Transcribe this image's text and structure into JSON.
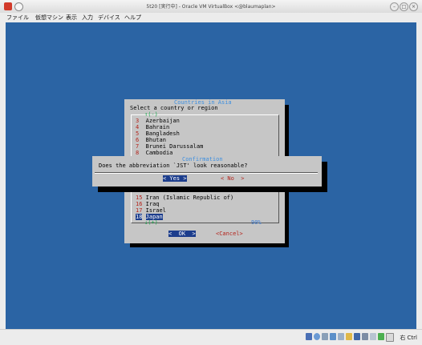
{
  "window": {
    "title": "5t20 [実行中] - Oracle VM VirtualBox <@blaumaplan>"
  },
  "menu": [
    "ファイル",
    "仮想マシン",
    "表示",
    "入力",
    "デバイス",
    "ヘルプ"
  ],
  "status": {
    "host_key": "右 Ctrl"
  },
  "countries_dialog": {
    "title": "Countries in Asia",
    "prompt": "Select a country or region",
    "scroll_top_tag": "↑(-)",
    "scroll_bottom_tag": "↓(+)",
    "percent": "90%",
    "items_top": [
      {
        "num": "3",
        "name": "Azerbaijan"
      },
      {
        "num": "4",
        "name": "Bahrain"
      },
      {
        "num": "5",
        "name": "Bangladesh"
      },
      {
        "num": "6",
        "name": "Bhutan"
      },
      {
        "num": "7",
        "name": "Brunei Darussalam"
      },
      {
        "num": "8",
        "name": "Cambodia"
      }
    ],
    "items_bottom": [
      {
        "num": "15",
        "name": "Iran (Islamic Republic of)"
      },
      {
        "num": "16",
        "name": "Iraq"
      },
      {
        "num": "17",
        "name": "Israel"
      },
      {
        "num": "18",
        "name": "Japan"
      }
    ],
    "ok_button": "<  OK  >",
    "cancel_button": "<Cancel>"
  },
  "confirm_dialog": {
    "title": "Confirmation",
    "question": "Does the abbreviation `JST' look reasonable?",
    "yes_button": "< Yes >",
    "no_button": "< No  >"
  }
}
